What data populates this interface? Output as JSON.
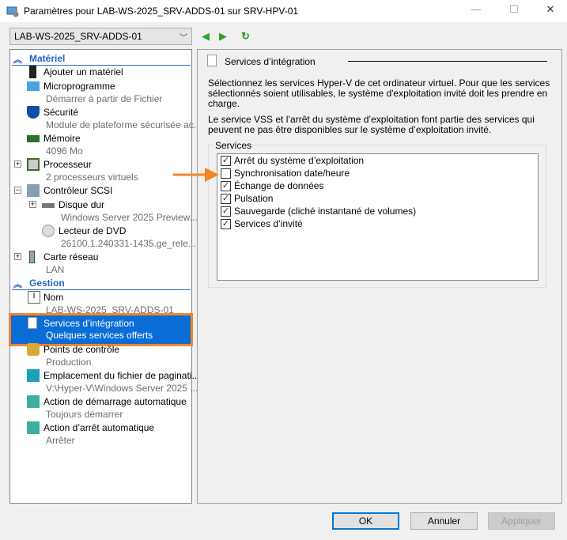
{
  "window": {
    "title": "Paramètres pour LAB-WS-2025_SRV-ADDS-01 sur SRV-HPV-01"
  },
  "toolbar": {
    "vm_selected": "LAB-WS-2025_SRV-ADDS-01"
  },
  "sidebar": {
    "categories": [
      {
        "label": "Matériel"
      },
      {
        "label": "Gestion"
      }
    ],
    "hardware": [
      {
        "label": "Ajouter un matériel",
        "sub": ""
      },
      {
        "label": "Microprogramme",
        "sub": "Démarrer à partir de Fichier"
      },
      {
        "label": "Sécurité",
        "sub": "Module de plateforme sécurisée ac..."
      },
      {
        "label": "Mémoire",
        "sub": "4096 Mo"
      },
      {
        "label": "Processeur",
        "sub": "2 processeurs virtuels"
      },
      {
        "label": "Contrôleur SCSI",
        "sub": ""
      },
      {
        "label": "Disque dur",
        "sub": "Windows Server 2025 Preview..."
      },
      {
        "label": "Lecteur de DVD",
        "sub": "26100.1.240331-1435.ge_rele..."
      },
      {
        "label": "Carte réseau",
        "sub": "LAN"
      }
    ],
    "management": [
      {
        "label": "Nom",
        "sub": "LAB-WS-2025_SRV-ADDS-01"
      },
      {
        "label": "Services d’intégration",
        "sub": "Quelques services offerts"
      },
      {
        "label": "Points de contrôle",
        "sub": "Production"
      },
      {
        "label": "Emplacement du fichier de paginati...",
        "sub": "V:\\Hyper-V\\Windows Server 2025 ..."
      },
      {
        "label": "Action de démarrage automatique",
        "sub": "Toujours démarrer"
      },
      {
        "label": "Action d’arrêt automatique",
        "sub": "Arrêter"
      }
    ]
  },
  "main": {
    "section_title": "Services d’intégration",
    "desc1": "Sélectionnez les services Hyper-V de cet ordinateur virtuel. Pour que les services sélectionnés soient utilisables, le système d'exploitation invité doit les prendre en charge.",
    "desc2": "Le service VSS et l’arrêt du système d’exploitation font partie des services qui peuvent ne pas être disponibles sur le système d’exploitation invité.",
    "group_label": "Services",
    "services": [
      {
        "label": "Arrêt du système d’exploitation",
        "checked": true
      },
      {
        "label": "Synchronisation date/heure",
        "checked": false
      },
      {
        "label": "Échange de données",
        "checked": true
      },
      {
        "label": "Pulsation",
        "checked": true
      },
      {
        "label": "Sauvegarde (cliché instantané de volumes)",
        "checked": true
      },
      {
        "label": "Services d’invité",
        "checked": true
      }
    ]
  },
  "buttons": {
    "ok": "OK",
    "cancel": "Annuler",
    "apply": "Appliquer"
  },
  "colors": {
    "selection": "#0a6dd6",
    "highlight": "#f5862a",
    "category": "#1e64c8"
  }
}
